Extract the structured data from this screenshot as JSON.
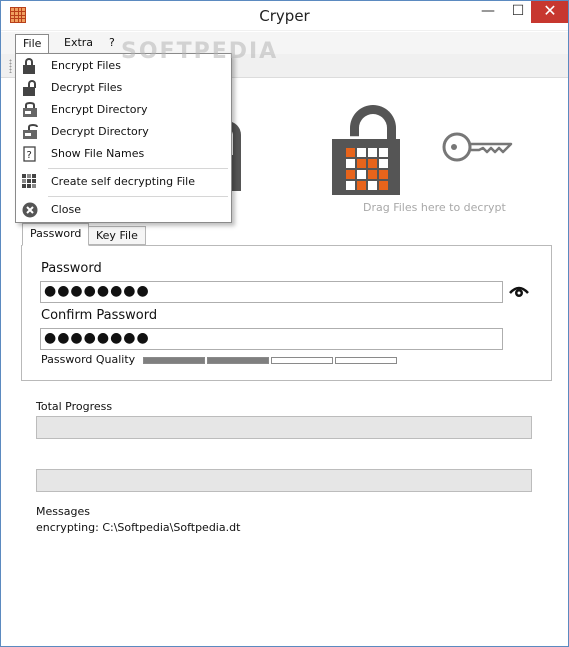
{
  "window": {
    "title": "Cryper",
    "controls": {
      "minimize": "—",
      "maximize": "☐",
      "close": "✕"
    }
  },
  "menubar": {
    "items": [
      {
        "label": "File"
      },
      {
        "label": "Extra"
      },
      {
        "label": "?"
      }
    ]
  },
  "file_menu": {
    "items": [
      {
        "label": "Encrypt Files",
        "icon": "lock-icon"
      },
      {
        "label": "Decrypt Files",
        "icon": "unlock-icon"
      },
      {
        "label": "Encrypt Directory",
        "icon": "lock-folder-icon"
      },
      {
        "label": "Decrypt Directory",
        "icon": "unlock-folder-icon"
      },
      {
        "label": "Show File Names",
        "icon": "question-file-icon"
      },
      {
        "label": "Create self decrypting File",
        "icon": "grid-icon"
      },
      {
        "label": "Close",
        "icon": "close-circle-icon"
      }
    ]
  },
  "drop_area": {
    "hint": "Drag Files here to decrypt",
    "accent": "#e8641b",
    "icon_color": "#555555"
  },
  "tabs": [
    {
      "label": "Password",
      "active": true
    },
    {
      "label": "Key File",
      "active": false
    }
  ],
  "password_panel": {
    "password_label": "Password",
    "password_value": "●●●●●●●●",
    "confirm_label": "Confirm Password",
    "confirm_value": "●●●●●●●●",
    "quality_label": "Password Quality",
    "quality_segments_filled": 2,
    "quality_segments_total": 4
  },
  "progress": {
    "total_label": "Total Progress",
    "total_value": 0,
    "file_value": 0
  },
  "messages": {
    "label": "Messages",
    "text": "encrypting: C:\\Softpedia\\Softpedia.dt"
  },
  "watermark": "SOFTPEDIA"
}
